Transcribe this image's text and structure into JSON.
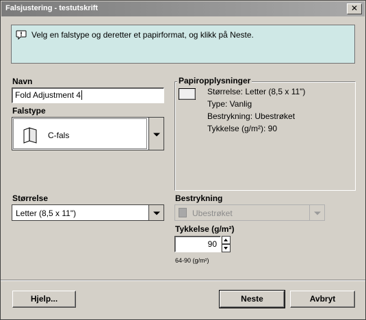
{
  "window": {
    "title": "Falsjustering - testutskrift",
    "close_glyph": "✕"
  },
  "info": {
    "icon": "speech-info-icon",
    "message": "Velg en falstype og deretter et papirformat, og klikk på Neste."
  },
  "name_field": {
    "label": "Navn",
    "value": "Fold Adjustment 4"
  },
  "fold_type": {
    "label": "Falstype",
    "icon": "c-fold-icon",
    "value": "C-fals"
  },
  "paper_info": {
    "title": "Papiropplysninger",
    "icon": "paper-icon",
    "lines": [
      "Størrelse: Letter (8,5 x 11\")",
      "Type: Vanlig",
      "Bestrykning: Ubestrøket",
      "Tykkelse (g/m²): 90"
    ]
  },
  "size": {
    "label": "Størrelse",
    "value": "Letter (8,5 x 11\")"
  },
  "coating": {
    "label": "Bestrykning",
    "value": "Ubestrøket",
    "enabled": false
  },
  "weight": {
    "label": "Tykkelse (g/m²)",
    "value": "90",
    "range": "64-90 (g/m²)"
  },
  "buttons": {
    "help": "Hjelp...",
    "next": "Neste",
    "cancel": "Avbryt"
  },
  "colors": {
    "info_bg": "#cfe8e6",
    "dialog_bg": "#d4d0c8",
    "disabled_text": "#8a8a8a"
  }
}
